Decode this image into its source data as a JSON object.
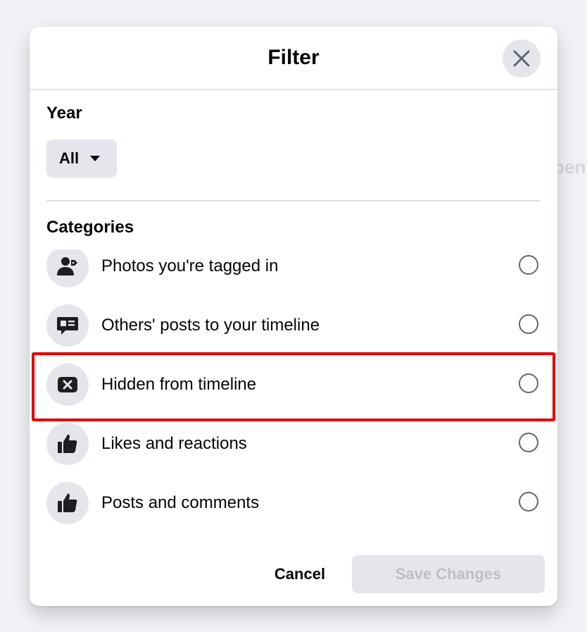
{
  "background": {
    "partial_text": "pen"
  },
  "dialog": {
    "title": "Filter",
    "close_icon": "close-icon"
  },
  "year": {
    "label": "Year",
    "selected": "All"
  },
  "categories": {
    "label": "Categories",
    "items": [
      {
        "label": "Photos you're tagged in",
        "icon": "tagged-person-icon",
        "selected": false
      },
      {
        "label": "Others' posts to your timeline",
        "icon": "chat-bubble-icon",
        "selected": false
      },
      {
        "label": "Hidden from timeline",
        "icon": "hidden-x-icon",
        "selected": false,
        "highlighted": true
      },
      {
        "label": "Likes and reactions",
        "icon": "thumbs-up-icon",
        "selected": false
      },
      {
        "label": "Posts and comments",
        "icon": "thumbs-up-icon",
        "selected": false
      }
    ]
  },
  "footer": {
    "cancel_label": "Cancel",
    "save_label": "Save Changes"
  },
  "colors": {
    "highlight_border": "#e00000",
    "icon_bg": "#e4e6eb",
    "disabled_text": "#bcc0c4"
  }
}
